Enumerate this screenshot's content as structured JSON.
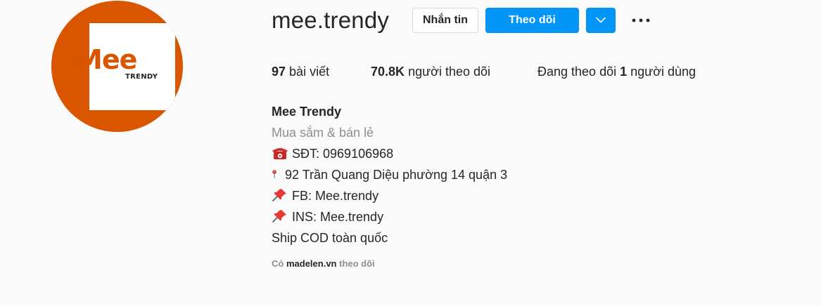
{
  "profile": {
    "username": "mee.trendy",
    "avatar": {
      "brand_text": "Mee",
      "sub_text": "TRENDY",
      "color": "#d95500"
    },
    "actions": {
      "message_label": "Nhắn tin",
      "follow_label": "Theo dõi",
      "dropdown_icon": "chevron-down-icon",
      "more_icon": "more-options-icon"
    },
    "stats": {
      "posts_count": "97",
      "posts_label": "bài viết",
      "followers_count": "70.8K",
      "followers_label": "người theo dõi",
      "following_prefix": "Đang theo dõi",
      "following_count": "1",
      "following_suffix": "người dùng"
    },
    "bio": {
      "full_name": "Mee Trendy",
      "category": "Mua sắm & bán lẻ",
      "phone": "SĐT: 0969106968",
      "address": "92 Trần Quang Diệu phường 14 quận 3",
      "facebook": "FB: Mee.trendy",
      "instagram": "INS: Mee.trendy",
      "shipping": "Ship COD toàn quốc"
    },
    "followed_by": {
      "prefix": "Có",
      "account": "madelen.vn",
      "suffix": "theo dõi"
    }
  },
  "colors": {
    "accent": "#0095f6",
    "text": "#262626",
    "muted": "#8e8e8e",
    "background": "#fafafa"
  }
}
